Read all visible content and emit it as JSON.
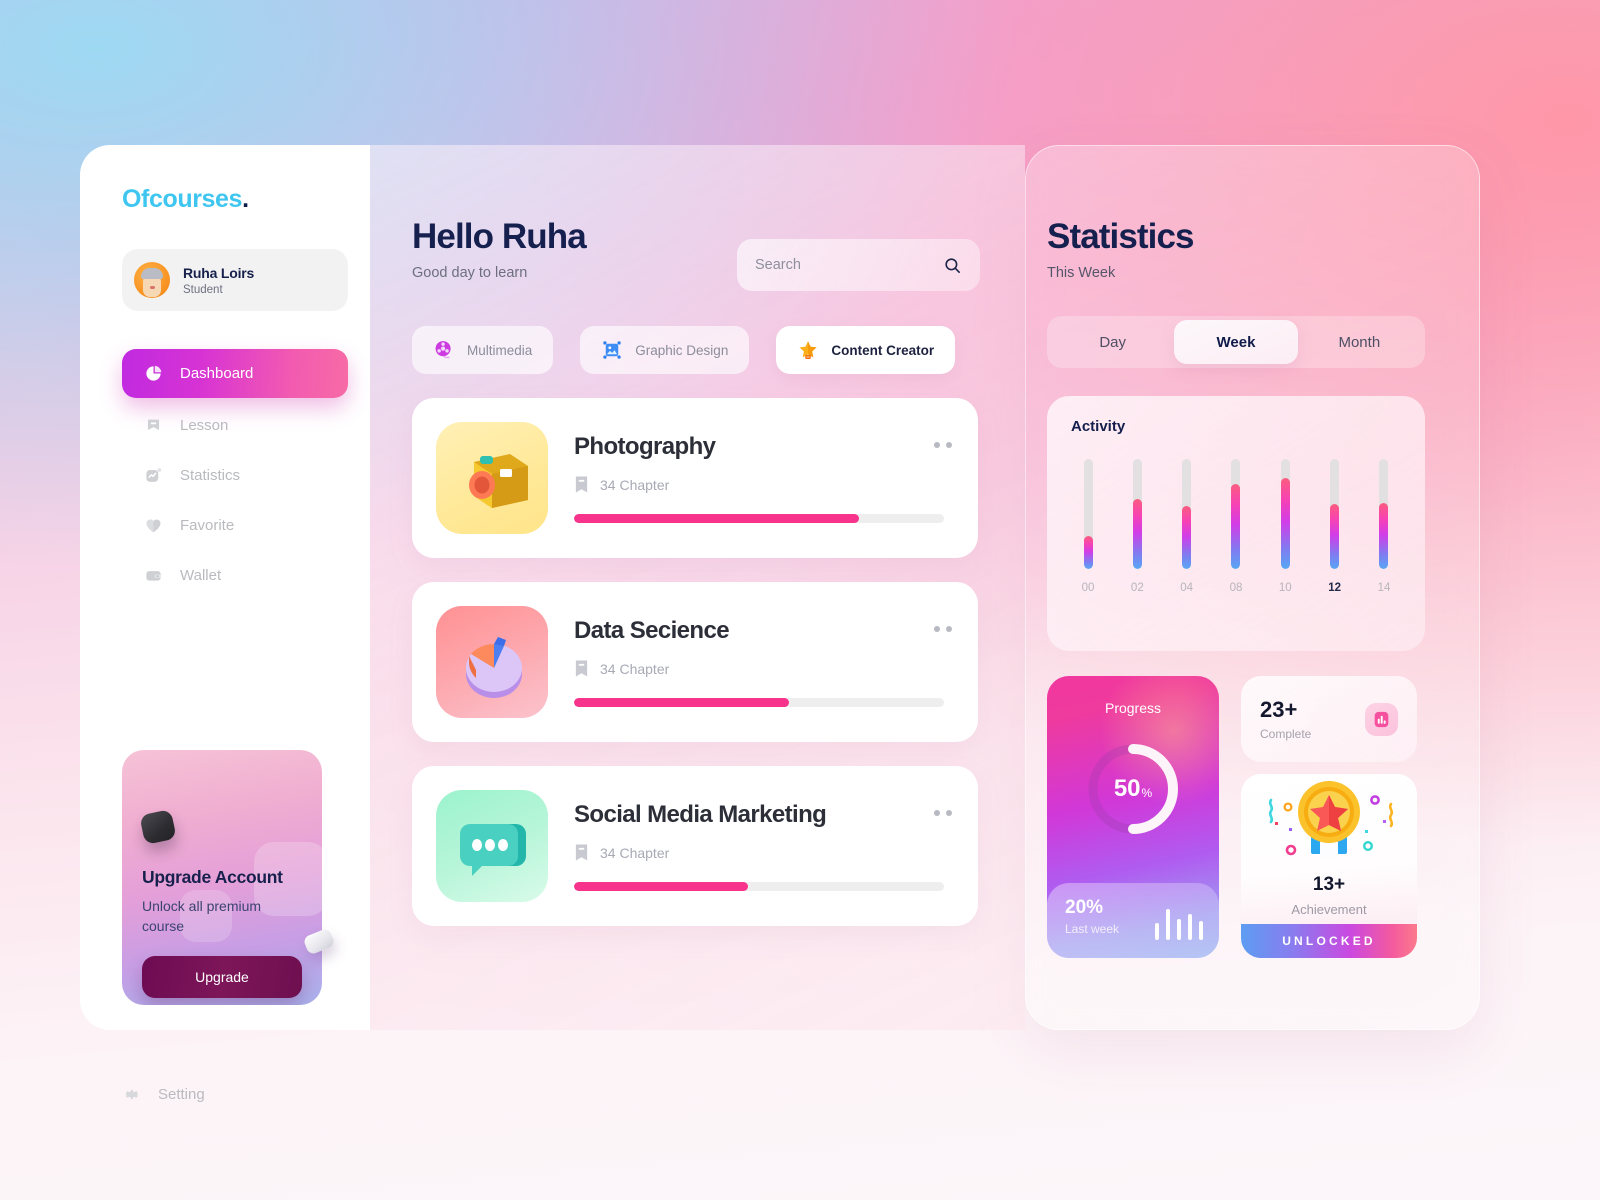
{
  "brand": {
    "name": "Ofcourses",
    "dot": "."
  },
  "profile": {
    "name": "Ruha Loirs",
    "role": "Student"
  },
  "sidebar": {
    "items": [
      {
        "label": "Dashboard",
        "icon": "pie-chart-icon",
        "active": true
      },
      {
        "label": "Lesson",
        "icon": "bookmark-icon",
        "active": false
      },
      {
        "label": "Statistics",
        "icon": "chart-square-icon",
        "active": false
      },
      {
        "label": "Favorite",
        "icon": "heart-icon",
        "active": false
      },
      {
        "label": "Wallet",
        "icon": "wallet-icon",
        "active": false
      }
    ],
    "setting": {
      "label": "Setting",
      "icon": "gear-icon"
    },
    "upgrade": {
      "title": "Upgrade Account",
      "subtitle": "Unlock all premium course",
      "button": "Upgrade"
    }
  },
  "header": {
    "greeting": "Hello Ruha",
    "subtitle": "Good day to learn",
    "search_placeholder": "Search",
    "search_value": "",
    "search_icon": "search-icon"
  },
  "categories": [
    {
      "label": "Multimedia",
      "icon": "film-reel-icon",
      "selected": false
    },
    {
      "label": "Graphic Design",
      "icon": "image-frame-icon",
      "selected": false
    },
    {
      "label": "Content Creator",
      "icon": "star-badge-icon",
      "selected": true
    }
  ],
  "courses": [
    {
      "title": "Photography",
      "chapters": "34 Chapter",
      "progress": 77,
      "thumb": "camera-icon",
      "menu_icon": "more-options-icon"
    },
    {
      "title": "Data Secience",
      "chapters": "34 Chapter",
      "progress": 58,
      "thumb": "pie-chart-3d-icon",
      "menu_icon": "more-options-icon"
    },
    {
      "title": "Social Media Marketing",
      "chapters": "34 Chapter",
      "progress": 47,
      "thumb": "chat-bubble-icon",
      "menu_icon": "more-options-icon"
    }
  ],
  "stats": {
    "title": "Statistics",
    "subtitle": "This Week",
    "range_tabs": [
      {
        "label": "Day",
        "active": false
      },
      {
        "label": "Week",
        "active": true
      },
      {
        "label": "Month",
        "active": false
      }
    ],
    "activity_title": "Activity",
    "progress": {
      "label": "Progress",
      "value": "50",
      "unit": "%",
      "last_week_value": "20%",
      "last_week_label": "Last week"
    },
    "complete": {
      "value": "23+",
      "label": "Complete",
      "icon": "bar-chart-icon"
    },
    "achievement": {
      "value": "13+",
      "label": "Achievement",
      "banner": "UNLOCKED",
      "icon": "medal-star-icon"
    }
  },
  "chart_data": {
    "type": "bar",
    "title": "Activity",
    "categories": [
      "00",
      "02",
      "04",
      "08",
      "10",
      "12",
      "14"
    ],
    "values": [
      30,
      64,
      57,
      77,
      83,
      59,
      60
    ],
    "highlight_category": "12",
    "xlabel": "",
    "ylabel": "",
    "ylim": [
      0,
      100
    ],
    "grid": false,
    "legend": "none"
  },
  "spark_data": {
    "type": "bar",
    "values": [
      40,
      75,
      50,
      62,
      45
    ],
    "title": "Last week activity"
  }
}
